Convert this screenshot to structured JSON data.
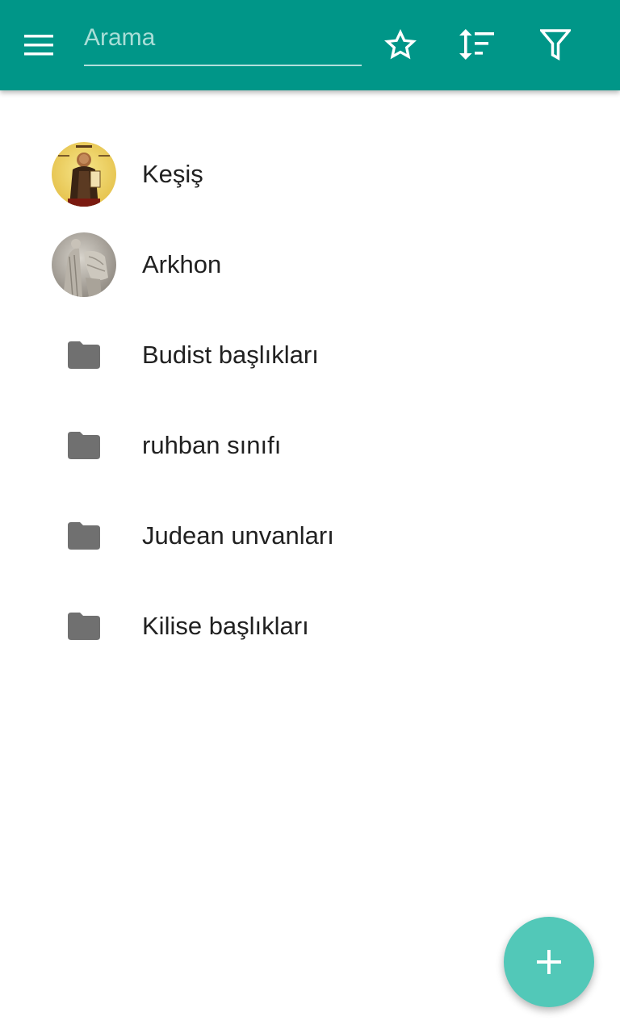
{
  "toolbar": {
    "background_color": "#009688",
    "menu_icon": "menu-icon",
    "search": {
      "placeholder": "Arama",
      "value": ""
    },
    "favorites_icon": "star-outline-icon",
    "sort_icon": "sort-icon",
    "filter_icon": "filter-icon"
  },
  "list": {
    "items": [
      {
        "label": "Keşiş",
        "type": "image",
        "icon": "monk-portrait-avatar"
      },
      {
        "label": "Arkhon",
        "type": "image",
        "icon": "archon-relief-avatar"
      },
      {
        "label": "Budist başlıkları",
        "type": "folder",
        "icon": "folder-icon"
      },
      {
        "label": "ruhban sınıfı",
        "type": "folder",
        "icon": "folder-icon"
      },
      {
        "label": "Judean unvanları",
        "type": "folder",
        "icon": "folder-icon"
      },
      {
        "label": "Kilise başlıkları",
        "type": "folder",
        "icon": "folder-icon"
      }
    ]
  },
  "fab": {
    "icon": "plus-icon",
    "color": "#52c8b8"
  }
}
